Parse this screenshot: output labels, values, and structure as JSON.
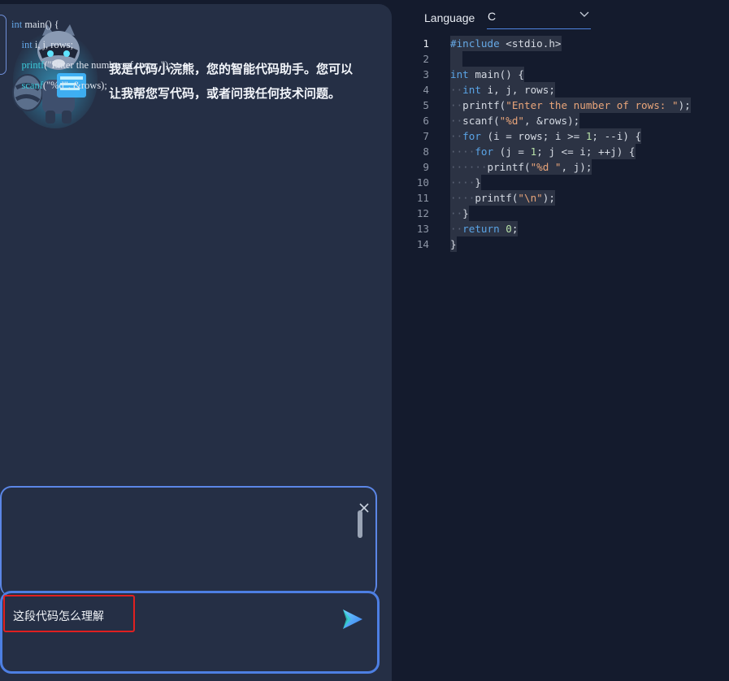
{
  "chat": {
    "greeting_line1": "我是代码小浣熊，您的智能代码助手。您可以",
    "greeting_line2": "让我帮您写代码，或者问我任何技术问题。",
    "quote_lines": [
      "int main() {",
      "int i, j, rows;",
      "printf(\"Enter the number of rows: \");",
      "scanf(\"%d\", &rows);"
    ],
    "input_text": "这段代码怎么理解"
  },
  "editor": {
    "language_label": "Language",
    "language_value": "C",
    "line_numbers": [
      "1",
      "2",
      "3",
      "4",
      "5",
      "6",
      "7",
      "8",
      "9",
      "10",
      "11",
      "12",
      "13",
      "14"
    ],
    "active_line": 1,
    "lines": [
      "#include <stdio.h>",
      "",
      "int main() {",
      "int i, j, rows;",
      "printf(\"Enter the number of rows: \");",
      "scanf(\"%d\", &rows);",
      "for (i = rows; i >= 1; --i) {",
      "for (j = 1; j <= i; ++j) {",
      "printf(\"%d \", j);",
      "}",
      "printf(\"\\n\");",
      "}",
      "return 0;",
      "}"
    ]
  },
  "colors": {
    "accent": "#4d7fe3",
    "highlight_box": "#e02020",
    "panel_bg": "#252f45",
    "editor_bg": "#141b2d"
  },
  "icons": {
    "mascot": "raccoon-mascot-icon",
    "close": "close-icon",
    "send": "send-icon",
    "chevron": "chevron-down-icon"
  }
}
